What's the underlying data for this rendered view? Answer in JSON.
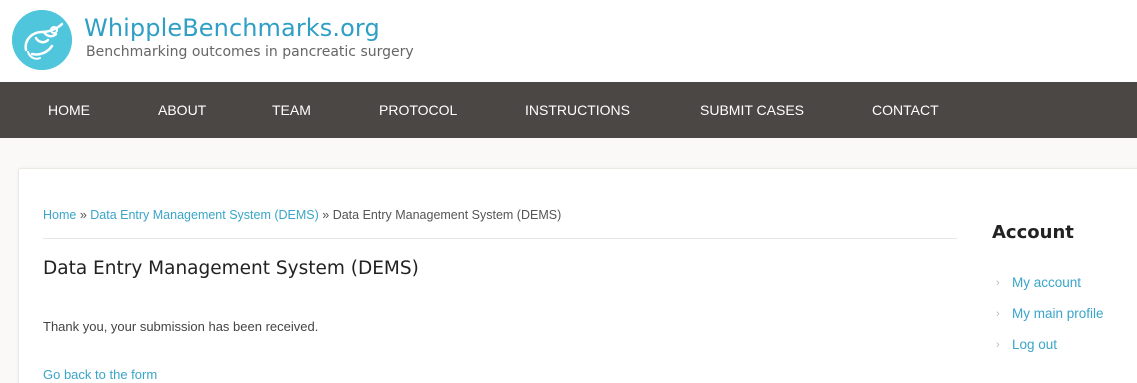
{
  "site": {
    "name": "WhippleBenchmarks.org",
    "slogan": "Benchmarking outcomes in pancreatic surgery"
  },
  "nav": {
    "items": [
      "HOME",
      "ABOUT",
      "TEAM",
      "PROTOCOL",
      "INSTRUCTIONS",
      "SUBMIT CASES",
      "CONTACT"
    ]
  },
  "breadcrumb": {
    "home": "Home",
    "sep": " » ",
    "parent": "Data Entry Management System (DEMS)",
    "current": "Data Entry Management System (DEMS)"
  },
  "main": {
    "title": "Data Entry Management System (DEMS)",
    "message": "Thank you, your submission has been received.",
    "back_link": "Go back to the form"
  },
  "sidebar": {
    "title": "Account",
    "items": [
      "My account",
      "My main profile",
      "Log out"
    ]
  },
  "colors": {
    "link": "#3aa5c9",
    "nav_bg": "#4a4745",
    "logo_bg": "#4fc6dc"
  }
}
